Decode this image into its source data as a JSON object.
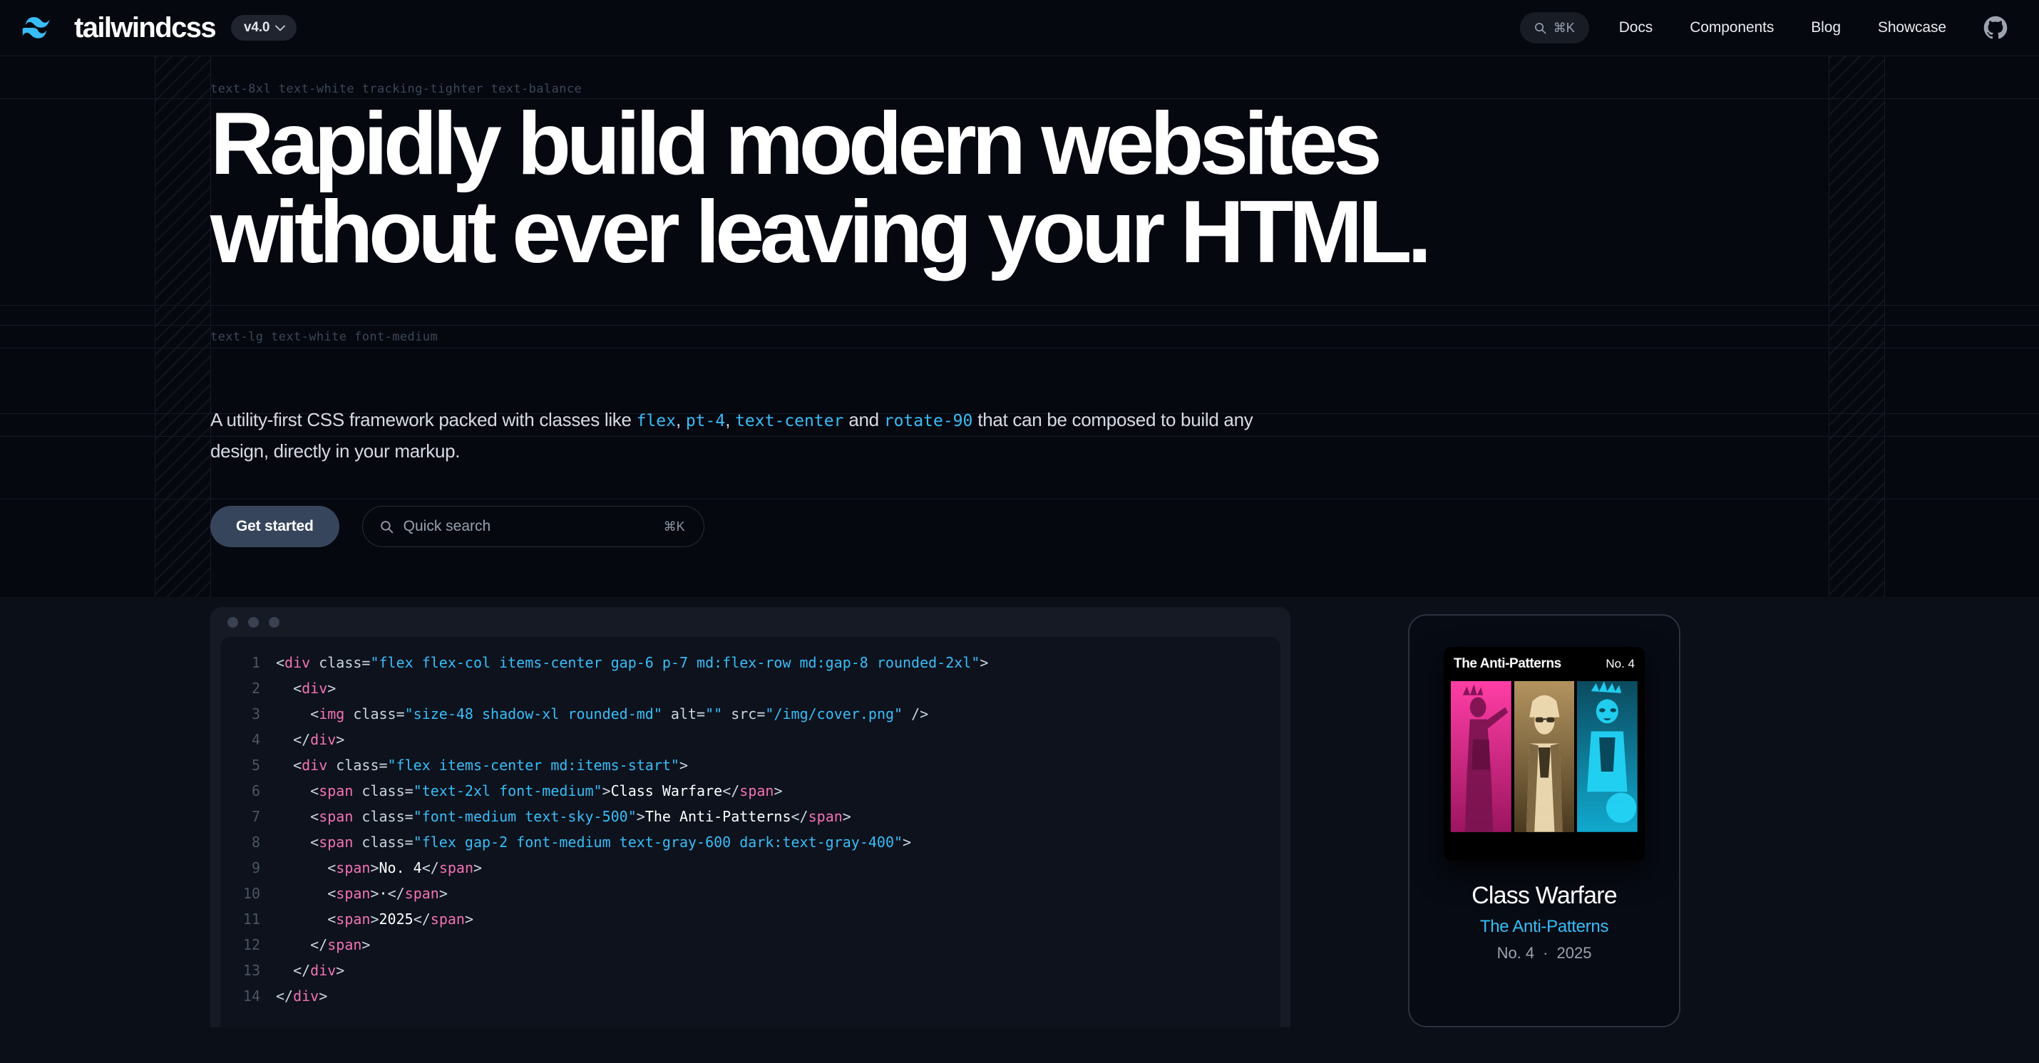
{
  "nav": {
    "brand": "tailwindcss",
    "logo_icon": "tailwind-wave-icon",
    "version": "v4.0",
    "version_chevron_icon": "chevron-down-icon",
    "search_icon": "search-icon",
    "search_kbd": "⌘K",
    "links": [
      {
        "label": "Docs"
      },
      {
        "label": "Components"
      },
      {
        "label": "Blog"
      },
      {
        "label": "Showcase"
      }
    ],
    "github_icon": "github-icon"
  },
  "hero": {
    "annotation_headline": "text-8xl text-white tracking-tighter text-balance",
    "annotation_subhead": "text-lg text-white font-medium",
    "headline_line1": "Rapidly build modern websites",
    "headline_line2": "without ever leaving your HTML.",
    "subhead": {
      "part1": "A utility-first CSS framework packed with classes like ",
      "code1": "flex",
      "sep1": ", ",
      "code2": "pt-4",
      "sep2": ", ",
      "code3": "text-center",
      "part2": " and ",
      "code4": "rotate-90",
      "part3": " that can be composed to build any design, directly in your markup."
    },
    "cta_primary": "Get started",
    "search_placeholder": "Quick search",
    "search_kbd": "⌘K",
    "search_icon": "search-icon"
  },
  "code_window": {
    "dots": [
      "window-dot",
      "window-dot",
      "window-dot"
    ],
    "lines": [
      {
        "n": "1",
        "tokens": [
          {
            "t": "punc",
            "v": "<"
          },
          {
            "t": "tag",
            "v": "div"
          },
          {
            "t": "attr",
            "v": " class="
          },
          {
            "t": "str",
            "v": "\"flex flex-col items-center gap-6 p-7 md:flex-row md:gap-8 rounded-2xl\""
          },
          {
            "t": "punc",
            "v": ">"
          }
        ]
      },
      {
        "n": "2",
        "tokens": [
          {
            "t": "punc",
            "v": "  <"
          },
          {
            "t": "tag",
            "v": "div"
          },
          {
            "t": "punc",
            "v": ">"
          }
        ]
      },
      {
        "n": "3",
        "tokens": [
          {
            "t": "punc",
            "v": "    <"
          },
          {
            "t": "tag",
            "v": "img"
          },
          {
            "t": "attr",
            "v": " class="
          },
          {
            "t": "str",
            "v": "\"size-48 shadow-xl rounded-md\""
          },
          {
            "t": "attr",
            "v": " alt="
          },
          {
            "t": "str",
            "v": "\"\""
          },
          {
            "t": "attr",
            "v": " src="
          },
          {
            "t": "str",
            "v": "\"/img/cover.png\""
          },
          {
            "t": "punc",
            "v": " />"
          }
        ]
      },
      {
        "n": "4",
        "tokens": [
          {
            "t": "punc",
            "v": "  </"
          },
          {
            "t": "tag",
            "v": "div"
          },
          {
            "t": "punc",
            "v": ">"
          }
        ]
      },
      {
        "n": "5",
        "tokens": [
          {
            "t": "punc",
            "v": "  <"
          },
          {
            "t": "tag",
            "v": "div"
          },
          {
            "t": "attr",
            "v": " class="
          },
          {
            "t": "str",
            "v": "\"flex items-center md:items-start\""
          },
          {
            "t": "punc",
            "v": ">"
          }
        ]
      },
      {
        "n": "6",
        "tokens": [
          {
            "t": "punc",
            "v": "    <"
          },
          {
            "t": "tag",
            "v": "span"
          },
          {
            "t": "attr",
            "v": " class="
          },
          {
            "t": "str",
            "v": "\"text-2xl font-medium\""
          },
          {
            "t": "punc",
            "v": ">"
          },
          {
            "t": "text",
            "v": "Class Warfare"
          },
          {
            "t": "punc",
            "v": "</"
          },
          {
            "t": "tag",
            "v": "span"
          },
          {
            "t": "punc",
            "v": ">"
          }
        ]
      },
      {
        "n": "7",
        "tokens": [
          {
            "t": "punc",
            "v": "    <"
          },
          {
            "t": "tag",
            "v": "span"
          },
          {
            "t": "attr",
            "v": " class="
          },
          {
            "t": "str",
            "v": "\"font-medium text-sky-500\""
          },
          {
            "t": "punc",
            "v": ">"
          },
          {
            "t": "text",
            "v": "The Anti-Patterns"
          },
          {
            "t": "punc",
            "v": "</"
          },
          {
            "t": "tag",
            "v": "span"
          },
          {
            "t": "punc",
            "v": ">"
          }
        ]
      },
      {
        "n": "8",
        "tokens": [
          {
            "t": "punc",
            "v": "    <"
          },
          {
            "t": "tag",
            "v": "span"
          },
          {
            "t": "attr",
            "v": " class="
          },
          {
            "t": "str",
            "v": "\"flex gap-2 font-medium text-gray-600 dark:text-gray-400\""
          },
          {
            "t": "punc",
            "v": ">"
          }
        ]
      },
      {
        "n": "9",
        "tokens": [
          {
            "t": "punc",
            "v": "      <"
          },
          {
            "t": "tag",
            "v": "span"
          },
          {
            "t": "punc",
            "v": ">"
          },
          {
            "t": "text",
            "v": "No. 4"
          },
          {
            "t": "punc",
            "v": "</"
          },
          {
            "t": "tag",
            "v": "span"
          },
          {
            "t": "punc",
            "v": ">"
          }
        ]
      },
      {
        "n": "10",
        "tokens": [
          {
            "t": "punc",
            "v": "      <"
          },
          {
            "t": "tag",
            "v": "span"
          },
          {
            "t": "punc",
            "v": ">"
          },
          {
            "t": "text",
            "v": "·"
          },
          {
            "t": "punc",
            "v": "</"
          },
          {
            "t": "tag",
            "v": "span"
          },
          {
            "t": "punc",
            "v": ">"
          }
        ]
      },
      {
        "n": "11",
        "tokens": [
          {
            "t": "punc",
            "v": "      <"
          },
          {
            "t": "tag",
            "v": "span"
          },
          {
            "t": "punc",
            "v": ">"
          },
          {
            "t": "text",
            "v": "2025"
          },
          {
            "t": "punc",
            "v": "</"
          },
          {
            "t": "tag",
            "v": "span"
          },
          {
            "t": "punc",
            "v": ">"
          }
        ]
      },
      {
        "n": "12",
        "tokens": [
          {
            "t": "punc",
            "v": "    </"
          },
          {
            "t": "tag",
            "v": "span"
          },
          {
            "t": "punc",
            "v": ">"
          }
        ]
      },
      {
        "n": "13",
        "tokens": [
          {
            "t": "punc",
            "v": "  </"
          },
          {
            "t": "tag",
            "v": "div"
          },
          {
            "t": "punc",
            "v": ">"
          }
        ]
      },
      {
        "n": "14",
        "tokens": [
          {
            "t": "punc",
            "v": "</"
          },
          {
            "t": "tag",
            "v": "div"
          },
          {
            "t": "punc",
            "v": ">"
          }
        ]
      }
    ]
  },
  "preview_card": {
    "album_title": "The Anti-Patterns",
    "album_number": "No. 4",
    "art_panels": [
      "magenta-punk-photo",
      "gold-punk-photo",
      "cyan-punk-photo"
    ],
    "title": "Class Warfare",
    "subtitle": "The Anti-Patterns",
    "issue": "No. 4",
    "dot": "·",
    "year": "2025"
  },
  "colors": {
    "background": "#05080f",
    "lower_band": "#0b0f18",
    "accent_sky": "#38bdf8",
    "code_tag": "#f472b6",
    "code_string": "#38bdf8",
    "button": "#37455c"
  }
}
